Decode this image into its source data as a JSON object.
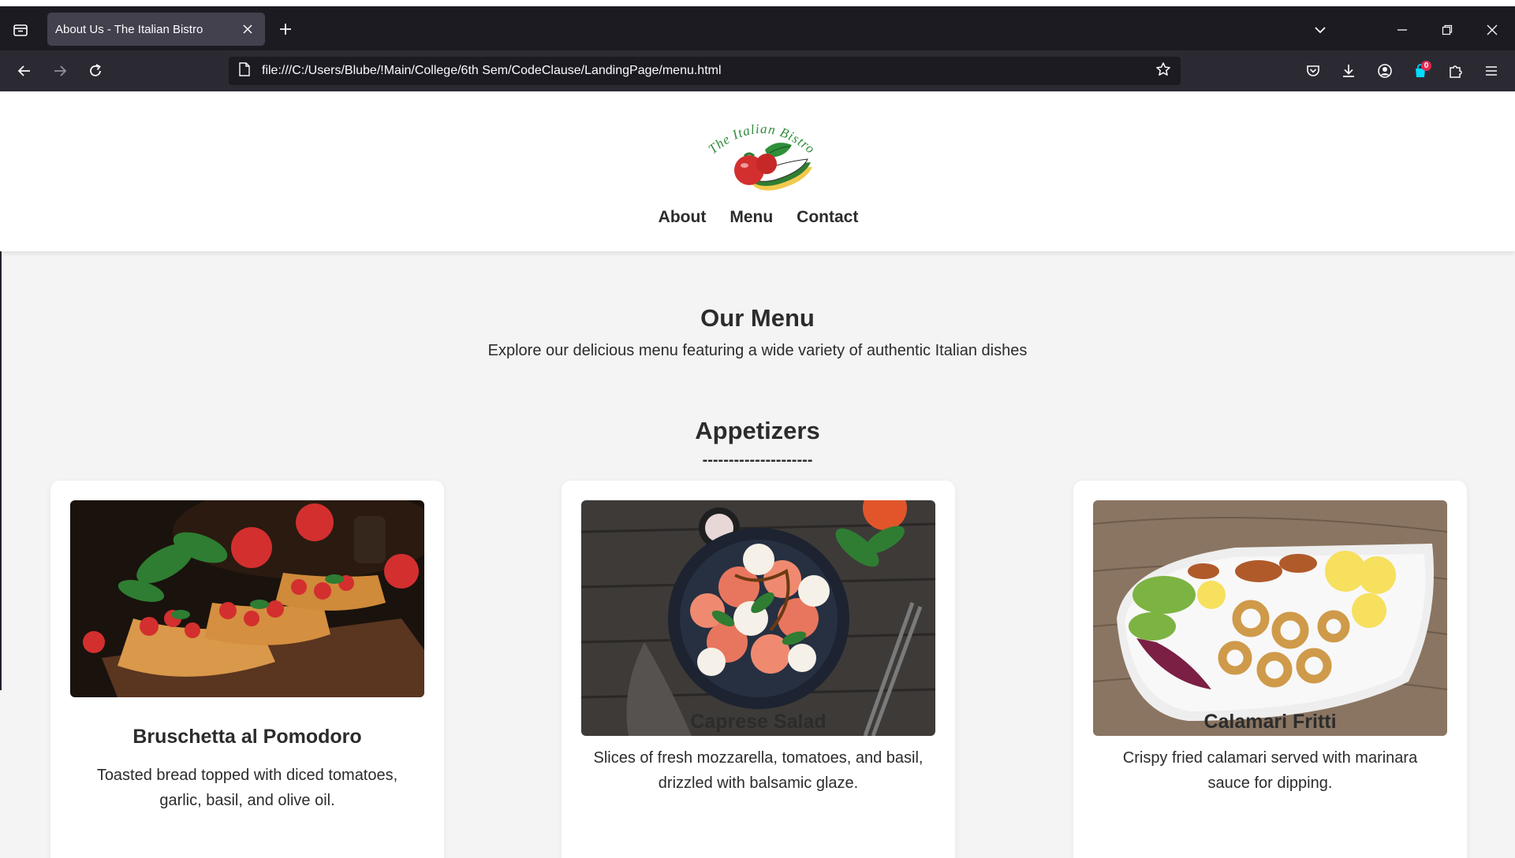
{
  "browser": {
    "tab_title": "About Us - The Italian Bistro",
    "url": "file:///C:/Users/Blube/!Main/College/6th Sem/CodeClause/LandingPage/menu.html",
    "extensions_badge": "0",
    "accent": "#00ddff"
  },
  "site": {
    "logo_text": "The Italian Bistro",
    "nav": [
      {
        "label": "About"
      },
      {
        "label": "Menu"
      },
      {
        "label": "Contact"
      }
    ]
  },
  "menu": {
    "title": "Our Menu",
    "subtitle": "Explore our delicious menu featuring a wide variety of authentic Italian dishes"
  },
  "section": {
    "title": "Appetizers",
    "divider": "---------------------"
  },
  "items": [
    {
      "name": "Bruschetta al Pomodoro",
      "description": "Toasted bread topped with diced tomatoes, garlic, basil, and olive oil.",
      "image": "bruschetta-photo"
    },
    {
      "name": "Caprese Salad",
      "description": "Slices of fresh mozzarella, tomatoes, and basil, drizzled with balsamic glaze.",
      "image": "caprese-salad-photo"
    },
    {
      "name": "Calamari Fritti",
      "description": "Crispy fried calamari served with marinara sauce for dipping.",
      "image": "calamari-photo"
    }
  ]
}
